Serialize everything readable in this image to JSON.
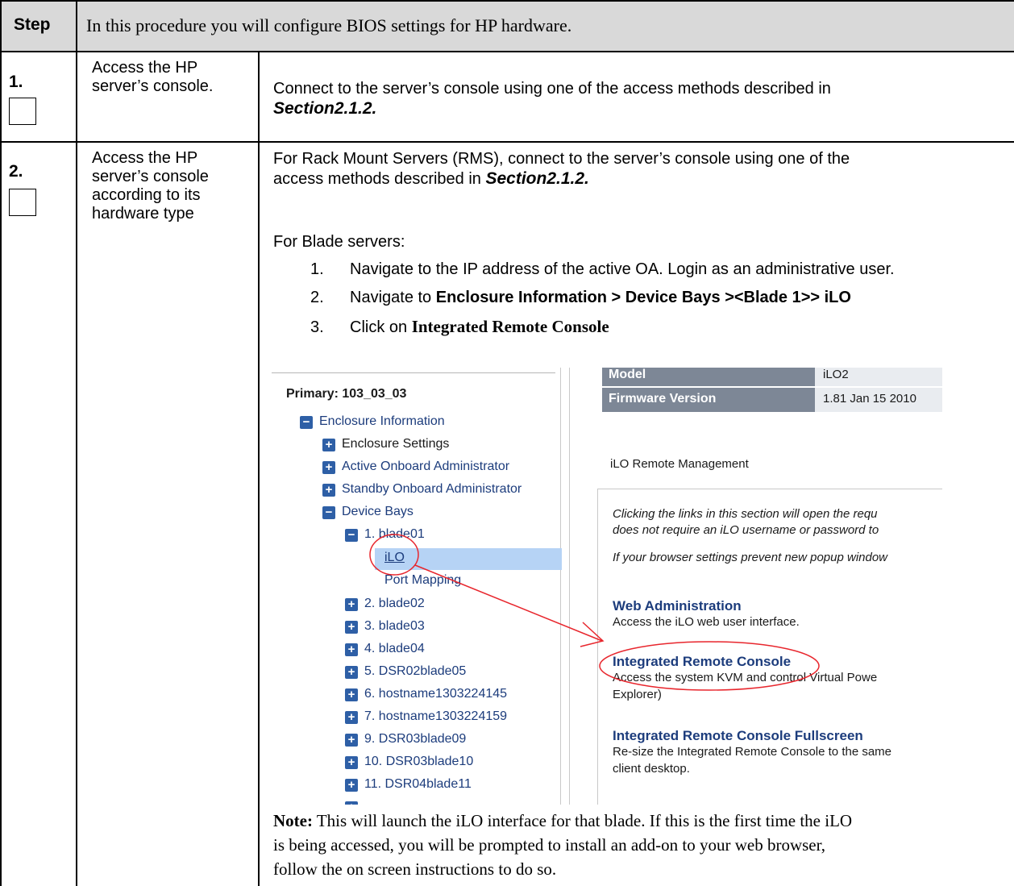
{
  "header": {
    "step_label": "Step",
    "intro": "In this procedure you will configure BIOS settings for HP hardware."
  },
  "steps": [
    {
      "number": "1.",
      "description": "Access the HP server’s console.",
      "text_before": "Connect to the server’s console using one of the access methods described in",
      "section_ref": "Section2.1.2."
    },
    {
      "number": "2.",
      "description_lines": [
        "Access the HP",
        "server’s console",
        "according to its",
        "hardware type"
      ],
      "rms_text_1": "For Rack Mount Servers (RMS), connect to the server’s console using one of the",
      "rms_text_2": "access methods described in",
      "section_ref": "Section2.1.2.",
      "blade_heading": "For Blade servers:",
      "list": [
        {
          "num": "1.",
          "text": "Navigate to the IP address of the active OA.  Login as an administrative user."
        },
        {
          "num": "2.",
          "prefix": "Navigate to ",
          "bold": "Enclosure Information > Device Bays ><Blade 1>> iLO"
        },
        {
          "num": "3.",
          "prefix": "Click on ",
          "bold": "Integrated Remote Console"
        }
      ],
      "note_label": "Note:",
      "note_line1": " This will launch the iLO interface for that blade. If this is the first time the iLO",
      "note_line2": "is being accessed, you will be prompted to install an add-on to your web browser,",
      "note_line3": "follow the on screen instructions to do so."
    }
  ],
  "screenshot": {
    "primary": "Primary: 103_03_03",
    "tree": {
      "enclosure_information": "Enclosure Information",
      "enclosure_settings": "Enclosure Settings",
      "active_oa": "Active Onboard Administrator",
      "standby_oa": "Standby Onboard Administrator",
      "device_bays": "Device Bays",
      "blade01": "1. blade01",
      "ilo": "iLO",
      "port_mapping": "Port Mapping",
      "bays": [
        "2. blade02",
        "3. blade03",
        "4. blade04",
        "5. DSR02blade05",
        "6. hostname1303224145",
        "7. hostname1303224159",
        "9. DSR03blade09",
        "10. DSR03blade10",
        "11. DSR04blade11"
      ]
    },
    "info": {
      "model_label": "Model",
      "model_value": "iLO2",
      "firmware_label": "Firmware Version",
      "firmware_value": "1.81 Jan 15 2010"
    },
    "remote_mgmt_title": "iLO Remote Management",
    "intro_line1": "Clicking the links in this section will open the requ",
    "intro_line2": "does not require an iLO username or password to",
    "popup_line": "If your browser settings prevent new popup window",
    "web_admin": "Web Administration",
    "web_admin_desc": "Access the iLO web user interface.",
    "irc": "Integrated Remote Console",
    "irc_desc1": "Access the system KVM and control Virtual Powe",
    "irc_desc2": "Explorer)",
    "ircf": "Integrated Remote Console Fullscreen",
    "ircf_desc1": "Re-size the Integrated Remote Console to the same",
    "ircf_desc2": "client desktop.",
    "annotation_color": "#e8262d"
  }
}
